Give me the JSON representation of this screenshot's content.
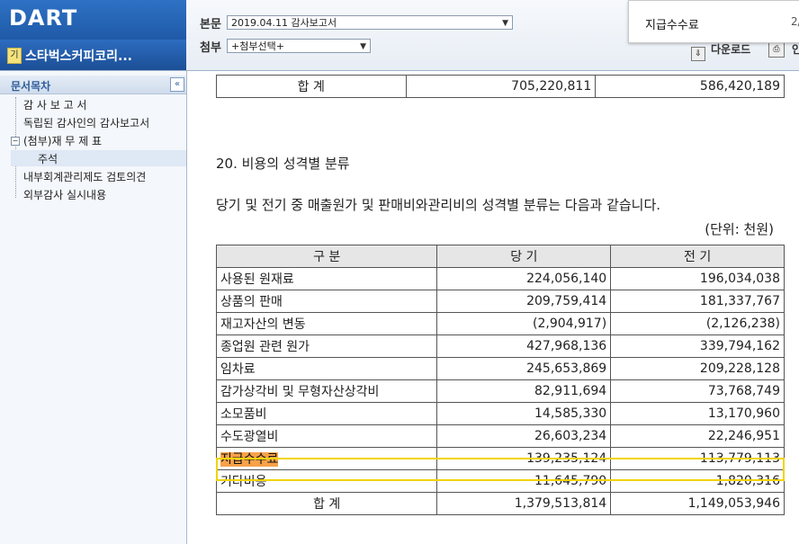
{
  "header": {
    "logo_text": "DART",
    "company_name": "스타벅스커피코리...",
    "company_icon": "기",
    "report_label": "본문",
    "report_value": "2019.04.11  감사보고서",
    "attach_label": "첨부",
    "attach_value": "+첨부선택+",
    "download_label": "다운로드",
    "print_label": "인"
  },
  "search_popup": {
    "query": "지급수수료",
    "count": "2/"
  },
  "sidebar": {
    "title": "문서목차",
    "collapse_symbol": "«",
    "items": [
      {
        "label": "감 사 보 고 서"
      },
      {
        "label": "독립된 감사인의 감사보고서"
      },
      {
        "label": "(첨부)재 무 제 표",
        "expand": "−"
      },
      {
        "label": "주석"
      },
      {
        "label": "내부회계관리제도 검토의견"
      },
      {
        "label": "외부감사 실시내용"
      }
    ]
  },
  "document": {
    "top_total": {
      "label": "합    계",
      "current": "705,220,811",
      "prior": "586,420,189"
    },
    "section_title": "20. 비용의 성격별 분류",
    "description": "당기 및 전기 중 매출원가 및 판매비와관리비의 성격별 분류는 다음과 같습니다.",
    "unit": "(단위: 천원)",
    "table": {
      "headers": [
        "구    분",
        "당    기",
        "전    기"
      ],
      "rows": [
        {
          "label": "사용된 원재료",
          "current": "224,056,140",
          "prior": "196,034,038"
        },
        {
          "label": "상품의 판매",
          "current": "209,759,414",
          "prior": "181,337,767"
        },
        {
          "label": "재고자산의 변동",
          "current": "(2,904,917)",
          "prior": "(2,126,238)"
        },
        {
          "label": "종업원 관련 원가",
          "current": "427,968,136",
          "prior": "339,794,162"
        },
        {
          "label": "임차료",
          "current": "245,653,869",
          "prior": "209,228,128"
        },
        {
          "label": "감가상각비 및 무형자산상각비",
          "current": "82,911,694",
          "prior": "73,768,749"
        },
        {
          "label": "소모품비",
          "current": "14,585,330",
          "prior": "13,170,960"
        },
        {
          "label": "수도광열비",
          "current": "26,603,234",
          "prior": "22,246,951"
        },
        {
          "label": "지급수수료",
          "current": "139,235,124",
          "prior": "113,779,113"
        },
        {
          "label": "기타비용",
          "current": "11,645,790",
          "prior": "1,820,316"
        }
      ],
      "total": {
        "label": "합    계",
        "current": "1,379,513,814",
        "prior": "1,149,053,946"
      }
    }
  },
  "colors": {
    "header_blue": "#1f5aa8",
    "search_highlight": "#f7a24a",
    "match_box": "#f0d400"
  }
}
